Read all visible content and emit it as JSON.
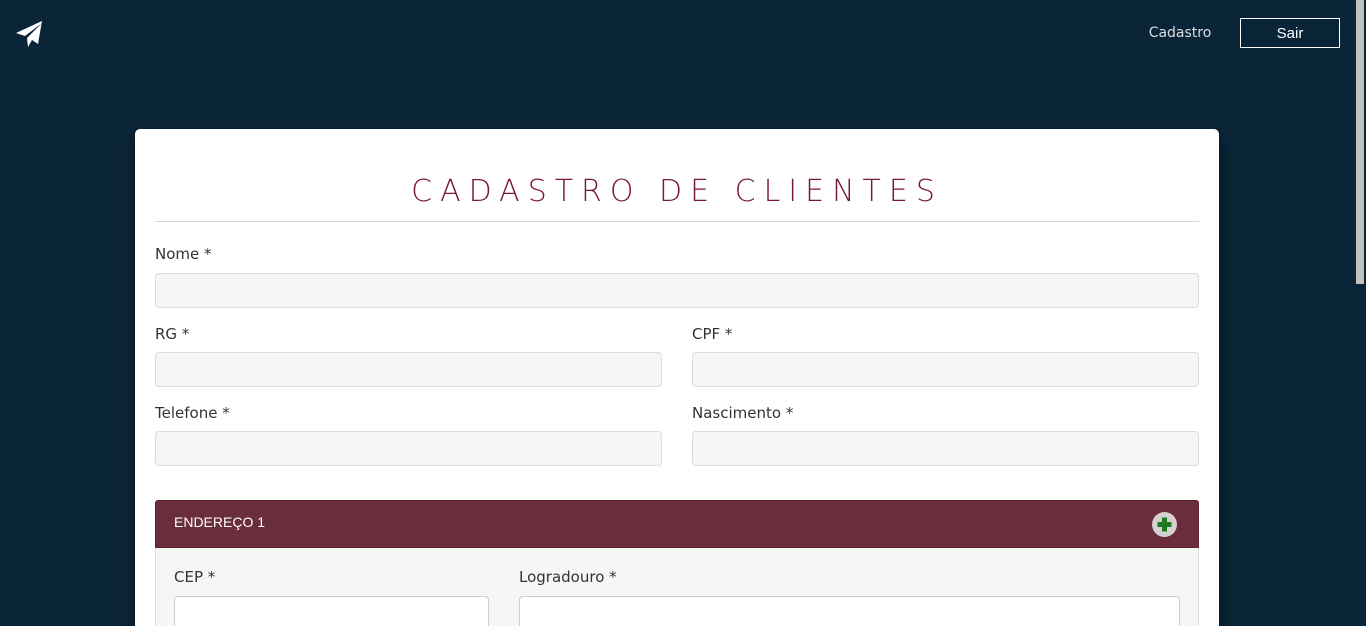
{
  "header": {
    "nav_cadastro": "Cadastro",
    "sair_label": "Sair",
    "logo_icon": "paper-plane-icon"
  },
  "form": {
    "title": "CADASTRO DE CLIENTES",
    "nome_label": "Nome *",
    "nome_value": "",
    "rg_label": "RG *",
    "rg_value": "",
    "cpf_label": "CPF *",
    "cpf_value": "",
    "telefone_label": "Telefone *",
    "telefone_value": "",
    "nascimento_label": "Nascimento *",
    "nascimento_value": ""
  },
  "address": {
    "panel_title": "ENDEREÇO 1",
    "add_icon": "plus-circle-icon",
    "cep_label": "CEP *",
    "cep_value": "",
    "logradouro_label": "Logradouro *",
    "logradouro_value": ""
  },
  "colors": {
    "background": "#0b2538",
    "title": "#7a1838",
    "panel_header": "#692d3b",
    "add_icon_plus": "#1e7a1e"
  }
}
